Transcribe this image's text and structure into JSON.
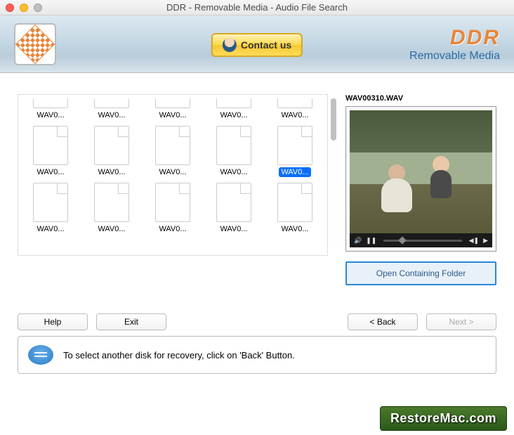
{
  "window": {
    "title": "DDR - Removable Media - Audio File Search"
  },
  "header": {
    "contact_label": "Contact us",
    "brand_main": "DDR",
    "brand_sub": "Removable Media"
  },
  "files": {
    "items": [
      {
        "label": "WAV0...",
        "row": "top-trunc"
      },
      {
        "label": "WAV0...",
        "row": "top-trunc"
      },
      {
        "label": "WAV0...",
        "row": "top-trunc"
      },
      {
        "label": "WAV0...",
        "row": "top-trunc"
      },
      {
        "label": "WAV0...",
        "row": "top-trunc"
      },
      {
        "label": "WAV0..."
      },
      {
        "label": "WAV0..."
      },
      {
        "label": "WAV0..."
      },
      {
        "label": "WAV0..."
      },
      {
        "label": "WAV0...",
        "selected": true
      },
      {
        "label": "WAV0..."
      },
      {
        "label": "WAV0..."
      },
      {
        "label": "WAV0..."
      },
      {
        "label": "WAV0..."
      },
      {
        "label": "WAV0..."
      }
    ]
  },
  "preview": {
    "filename": "WAV00310.WAV",
    "open_folder_label": "Open Containing Folder"
  },
  "buttons": {
    "help": "Help",
    "exit": "Exit",
    "back": "< Back",
    "next": "Next >"
  },
  "hint": "To select another disk for recovery, click on 'Back' Button.",
  "watermark": "RestoreMac.com"
}
